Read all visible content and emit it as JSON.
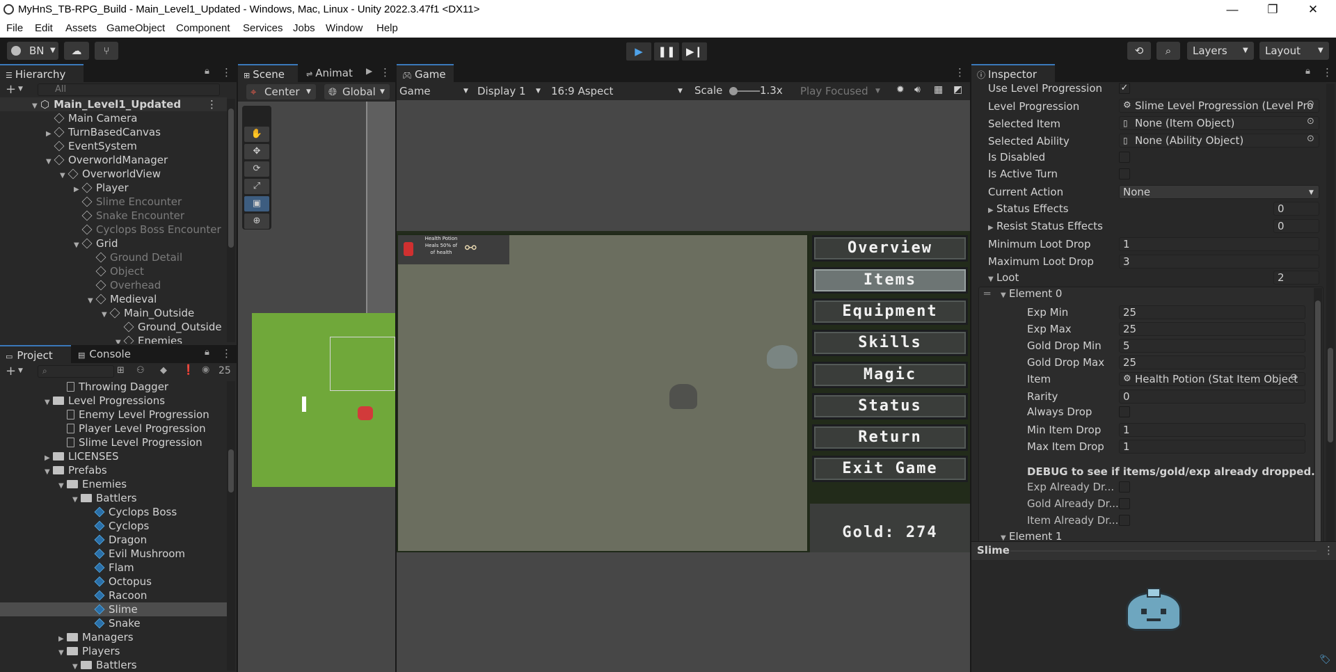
{
  "window": {
    "title": "MyHnS_TB-RPG_Build - Main_Level1_Updated - Windows, Mac, Linux - Unity 2022.3.47f1 <DX11>",
    "min": "—",
    "restore": "❐",
    "close": "✕"
  },
  "menu": [
    "File",
    "Edit",
    "Assets",
    "GameObject",
    "Component",
    "Services",
    "Jobs",
    "Window",
    "Help"
  ],
  "toolbar": {
    "account": "BN",
    "layers": "Layers",
    "layout": "Layout"
  },
  "hierarchy": {
    "tab": "Hierarchy",
    "search_placeholder": "All",
    "rows": [
      {
        "label": "Main_Level1_Updated",
        "indent": 0,
        "arrow": "▼",
        "kind": "scene",
        "dim": false
      },
      {
        "label": "Main Camera",
        "indent": 1,
        "arrow": "",
        "kind": "cube",
        "dim": false
      },
      {
        "label": "TurnBasedCanvas",
        "indent": 1,
        "arrow": "▶",
        "kind": "cube",
        "dim": false
      },
      {
        "label": "EventSystem",
        "indent": 1,
        "arrow": "",
        "kind": "cube",
        "dim": false
      },
      {
        "label": "OverworldManager",
        "indent": 1,
        "arrow": "▼",
        "kind": "cube",
        "dim": false
      },
      {
        "label": "OverworldView",
        "indent": 2,
        "arrow": "▼",
        "kind": "cube",
        "dim": false
      },
      {
        "label": "Player",
        "indent": 3,
        "arrow": "▶",
        "kind": "cube",
        "dim": false
      },
      {
        "label": "Slime Encounter",
        "indent": 3,
        "arrow": "",
        "kind": "cube",
        "dim": true
      },
      {
        "label": "Snake Encounter",
        "indent": 3,
        "arrow": "",
        "kind": "cube",
        "dim": true
      },
      {
        "label": "Cyclops Boss Encounter",
        "indent": 3,
        "arrow": "",
        "kind": "cube",
        "dim": true
      },
      {
        "label": "Grid",
        "indent": 3,
        "arrow": "▼",
        "kind": "cube",
        "dim": false
      },
      {
        "label": "Ground Detail",
        "indent": 4,
        "arrow": "",
        "kind": "cube",
        "dim": true
      },
      {
        "label": "Object",
        "indent": 4,
        "arrow": "",
        "kind": "cube",
        "dim": true
      },
      {
        "label": "Overhead",
        "indent": 4,
        "arrow": "",
        "kind": "cube",
        "dim": true
      },
      {
        "label": "Medieval",
        "indent": 4,
        "arrow": "▼",
        "kind": "cube",
        "dim": false
      },
      {
        "label": "Main_Outside",
        "indent": 5,
        "arrow": "▼",
        "kind": "cube",
        "dim": false
      },
      {
        "label": "Ground_Outside",
        "indent": 6,
        "arrow": "",
        "kind": "cube",
        "dim": false
      },
      {
        "label": "Enemies",
        "indent": 6,
        "arrow": "▼",
        "kind": "cube",
        "dim": false
      }
    ]
  },
  "project": {
    "tab_project": "Project",
    "tab_console": "Console",
    "count": "25",
    "rows": [
      {
        "label": "Throwing Dagger",
        "indent": 4,
        "arrow": "",
        "kind": "file",
        "sel": false
      },
      {
        "label": "Level Progressions",
        "indent": 3,
        "arrow": "▼",
        "kind": "folder",
        "sel": false
      },
      {
        "label": "Enemy Level Progression",
        "indent": 4,
        "arrow": "",
        "kind": "file",
        "sel": false
      },
      {
        "label": "Player Level Progression",
        "indent": 4,
        "arrow": "",
        "kind": "file",
        "sel": false
      },
      {
        "label": "Slime Level Progression",
        "indent": 4,
        "arrow": "",
        "kind": "file",
        "sel": false
      },
      {
        "label": "LICENSES",
        "indent": 3,
        "arrow": "▶",
        "kind": "folder",
        "sel": false
      },
      {
        "label": "Prefabs",
        "indent": 3,
        "arrow": "▼",
        "kind": "folder",
        "sel": false
      },
      {
        "label": "Enemies",
        "indent": 4,
        "arrow": "▼",
        "kind": "folder",
        "sel": false
      },
      {
        "label": "Battlers",
        "indent": 5,
        "arrow": "▼",
        "kind": "folder",
        "sel": false
      },
      {
        "label": "Cyclops Boss",
        "indent": 6,
        "arrow": "",
        "kind": "prefab",
        "sel": false
      },
      {
        "label": "Cyclops",
        "indent": 6,
        "arrow": "",
        "kind": "prefab",
        "sel": false
      },
      {
        "label": "Dragon",
        "indent": 6,
        "arrow": "",
        "kind": "prefab",
        "sel": false
      },
      {
        "label": "Evil Mushroom",
        "indent": 6,
        "arrow": "",
        "kind": "prefab",
        "sel": false
      },
      {
        "label": "Flam",
        "indent": 6,
        "arrow": "",
        "kind": "prefab",
        "sel": false
      },
      {
        "label": "Octopus",
        "indent": 6,
        "arrow": "",
        "kind": "prefab",
        "sel": false
      },
      {
        "label": "Racoon",
        "indent": 6,
        "arrow": "",
        "kind": "prefab",
        "sel": false
      },
      {
        "label": "Slime",
        "indent": 6,
        "arrow": "",
        "kind": "prefab",
        "sel": true
      },
      {
        "label": "Snake",
        "indent": 6,
        "arrow": "",
        "kind": "prefab",
        "sel": false
      },
      {
        "label": "Managers",
        "indent": 4,
        "arrow": "▶",
        "kind": "folder",
        "sel": false
      },
      {
        "label": "Players",
        "indent": 4,
        "arrow": "▼",
        "kind": "folder",
        "sel": false
      },
      {
        "label": "Battlers",
        "indent": 5,
        "arrow": "▼",
        "kind": "folder",
        "sel": false
      }
    ]
  },
  "scene": {
    "tab_scene": "Scene",
    "tab_animator": "Animat",
    "pivot": "Center",
    "space": "Global"
  },
  "game": {
    "tab": "Game",
    "view": "Game",
    "display": "Display 1",
    "aspect": "16:9 Aspect",
    "scale_label": "Scale",
    "scale": "1.3x",
    "play_mode": "Play Focused",
    "item_desc_lines": [
      "Health Potion",
      "Heals 50% of",
      "of health"
    ],
    "menu_buttons": [
      "Overview",
      "Items",
      "Equipment",
      "Skills",
      "Magic",
      "Status",
      "Return",
      "Exit Game"
    ],
    "active_button": "Items",
    "gold": "Gold: 274"
  },
  "inspector": {
    "tab": "Inspector",
    "fields": {
      "use_level_progression": "Use Level Progression",
      "level_progression": "Level Progression",
      "level_progression_val": "Slime Level Progression (Level Pro",
      "selected_item": "Selected Item",
      "selected_item_val": "None (Item Object)",
      "selected_ability": "Selected Ability",
      "selected_ability_val": "None (Ability Object)",
      "is_disabled": "Is Disabled",
      "is_active_turn": "Is Active Turn",
      "current_action": "Current Action",
      "current_action_val": "None",
      "status_effects": "Status Effects",
      "status_effects_val": "0",
      "resist_status_effects": "Resist Status Effects",
      "resist_status_effects_val": "0",
      "min_loot": "Minimum Loot Drop",
      "min_loot_val": "1",
      "max_loot": "Maximum Loot Drop",
      "max_loot_val": "3",
      "loot": "Loot",
      "loot_val": "2",
      "element0": "Element 0",
      "exp_min": "Exp Min",
      "exp_min_val": "25",
      "exp_max": "Exp Max",
      "exp_max_val": "25",
      "gold_min": "Gold Drop Min",
      "gold_min_val": "5",
      "gold_max": "Gold Drop Max",
      "gold_max_val": "25",
      "item": "Item",
      "item_val": "Health Potion (Stat Item Object",
      "rarity": "Rarity",
      "rarity_val": "0",
      "always_drop": "Always Drop",
      "min_item_drop": "Min Item Drop",
      "min_item_drop_val": "1",
      "max_item_drop": "Max Item Drop",
      "max_item_drop_val": "1",
      "debug_note": "DEBUG to see if items/gold/exp already dropped.",
      "exp_dropped": "Exp Already Dr...",
      "gold_dropped": "Gold Already Dr...",
      "item_dropped": "Item Already Dr...",
      "element1": "Element 1"
    },
    "preview_title": "Slime"
  }
}
